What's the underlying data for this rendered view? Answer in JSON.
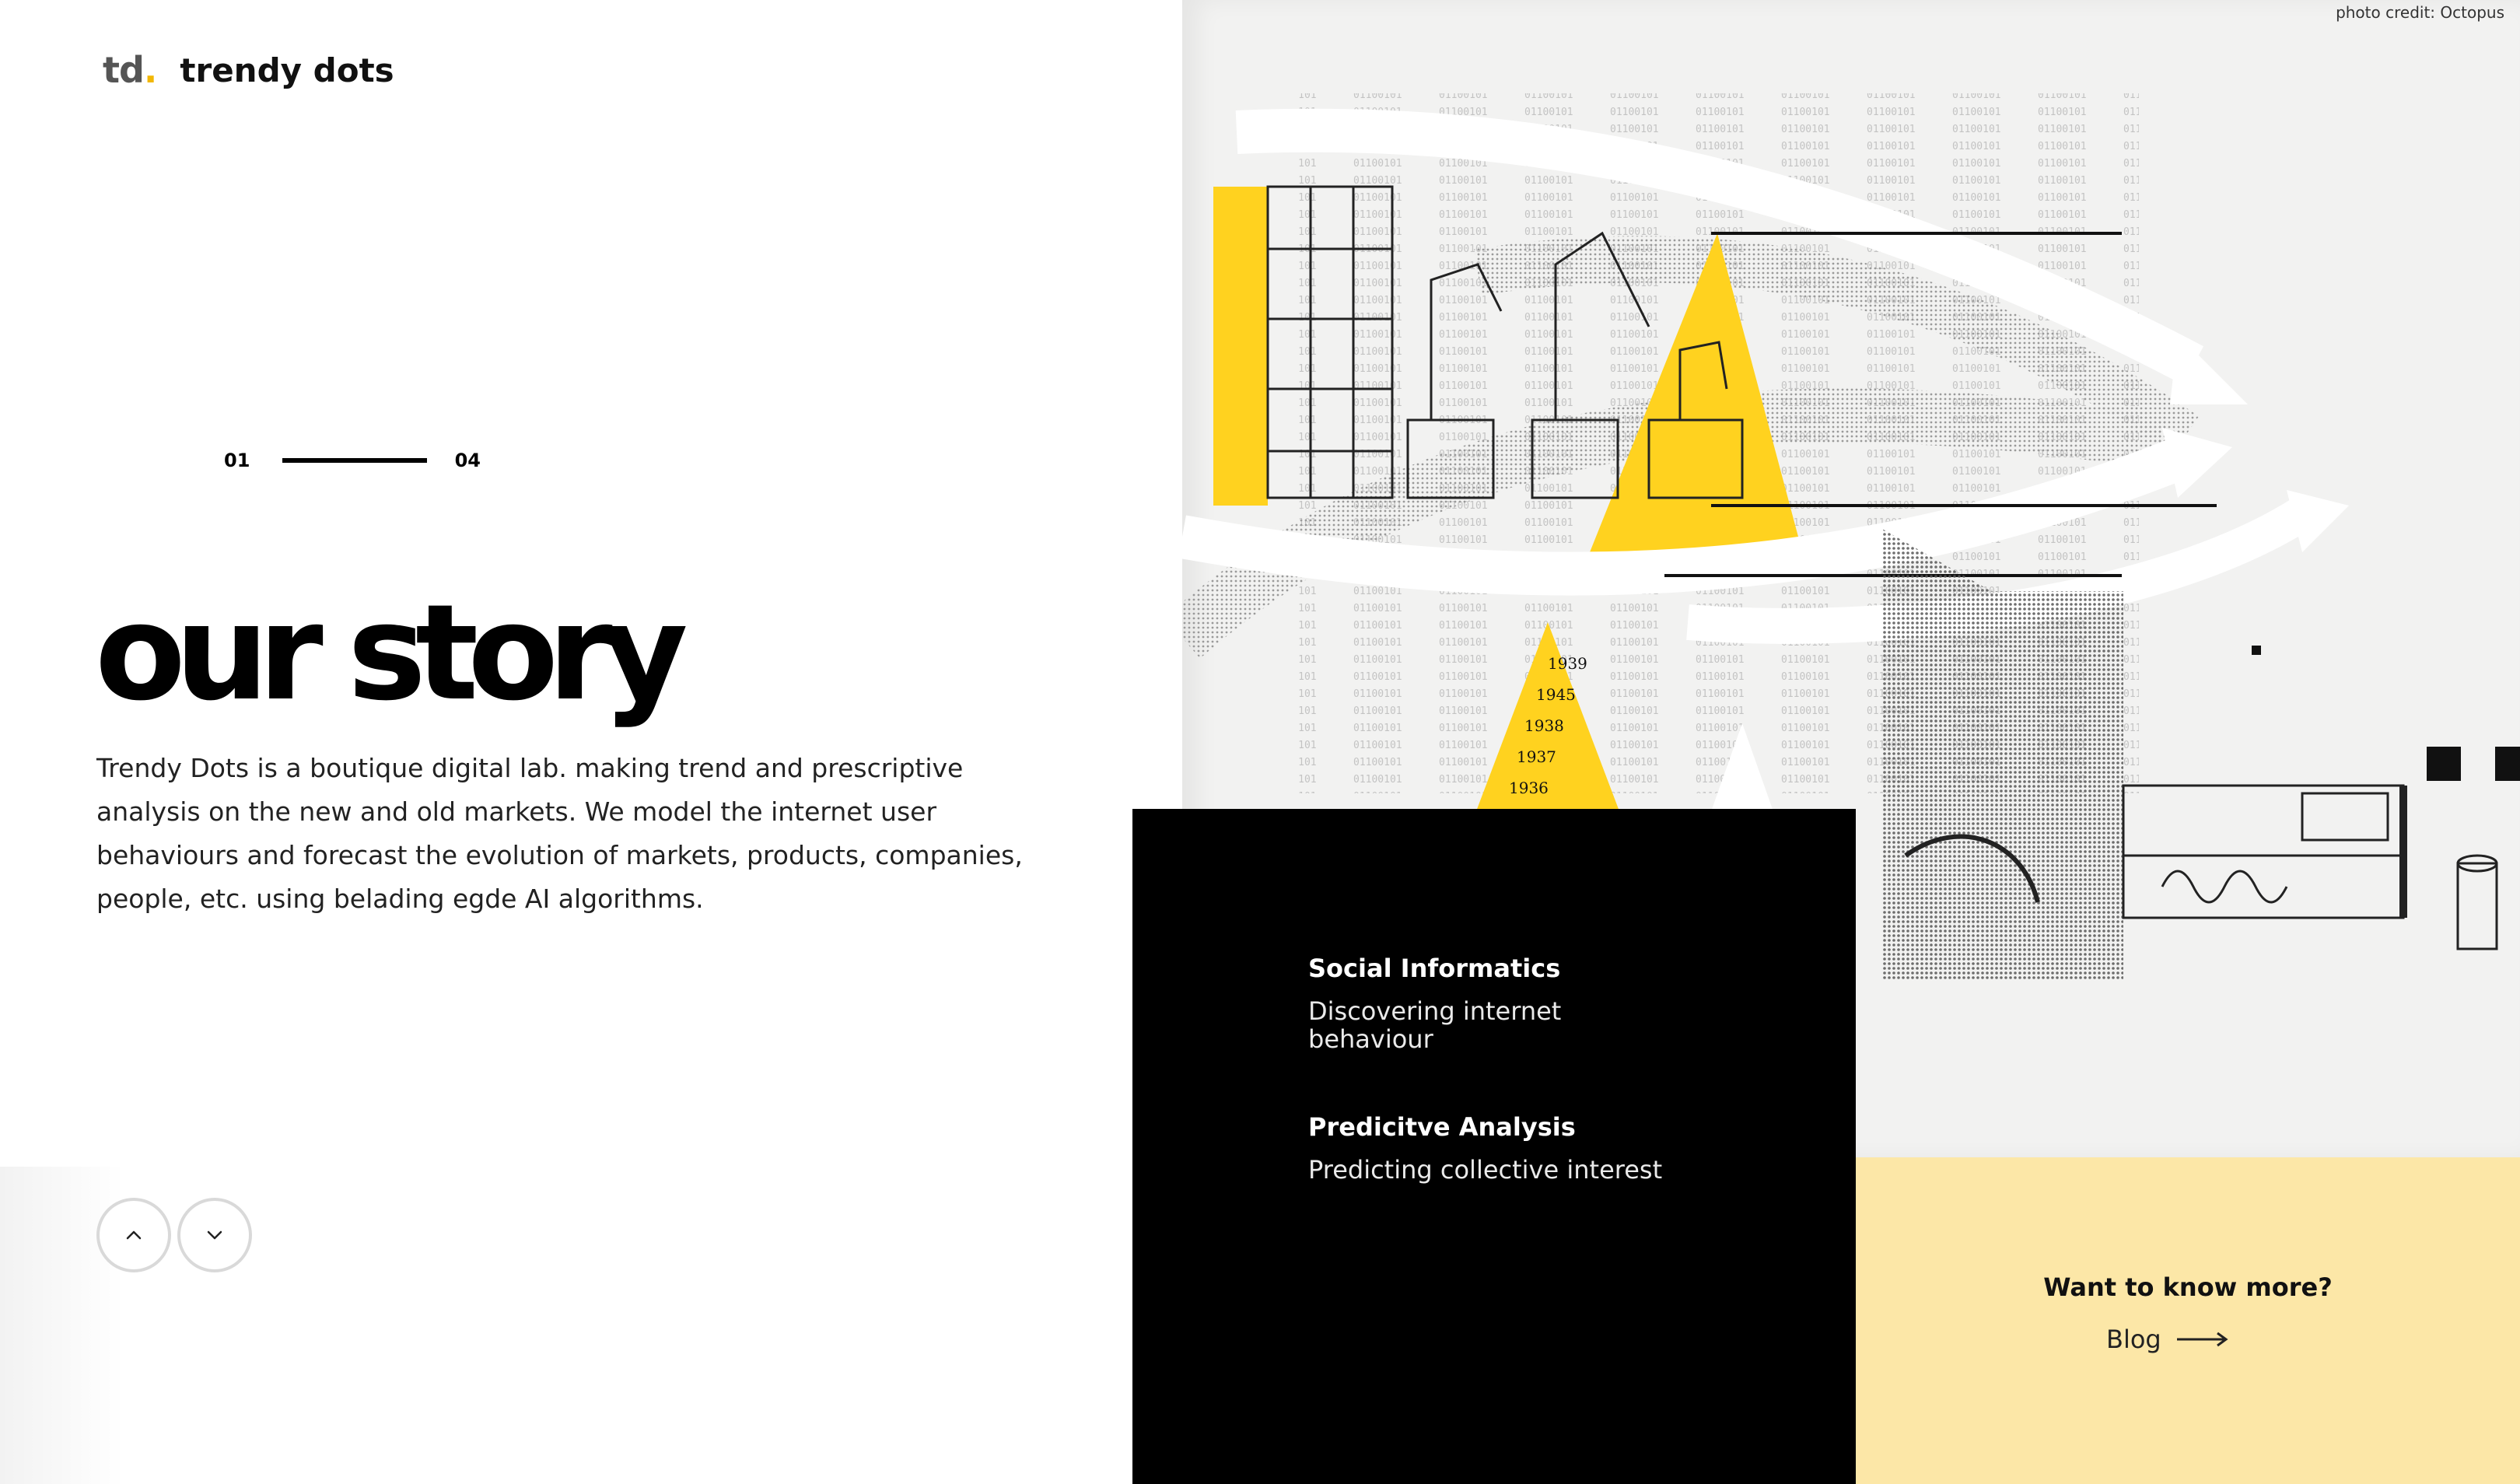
{
  "brand": {
    "mark": "td",
    "mark_dot": ".",
    "name": "trendy dots"
  },
  "pager": {
    "current": "01",
    "total": "04"
  },
  "hero": {
    "title": "our story",
    "body": "Trendy Dots is a boutique digital lab. making trend and prescriptive analysis on the new and old markets. We model the internet user behaviours and forecast the evolution of markets, products, companies, people, etc. using belading egde AI algorithms."
  },
  "nav": {
    "up_icon": "chevron-up-icon",
    "down_icon": "chevron-down-icon"
  },
  "collage": {
    "photo_credit": "photo credit: Octopus"
  },
  "services": [
    {
      "title": "Social Informatics",
      "description": "Discovering internet behaviour"
    },
    {
      "title": "Predicitve Analysis",
      "description": "Predicting collective interest"
    }
  ],
  "cta": {
    "question": "Want to know more?",
    "link_label": "Blog",
    "link_icon": "arrow-right-icon"
  },
  "colors": {
    "accent_yellow": "#F2B705",
    "collage_yellow": "#FFD21F",
    "cta_bg": "#FCE7A7",
    "dark": "#000000"
  }
}
